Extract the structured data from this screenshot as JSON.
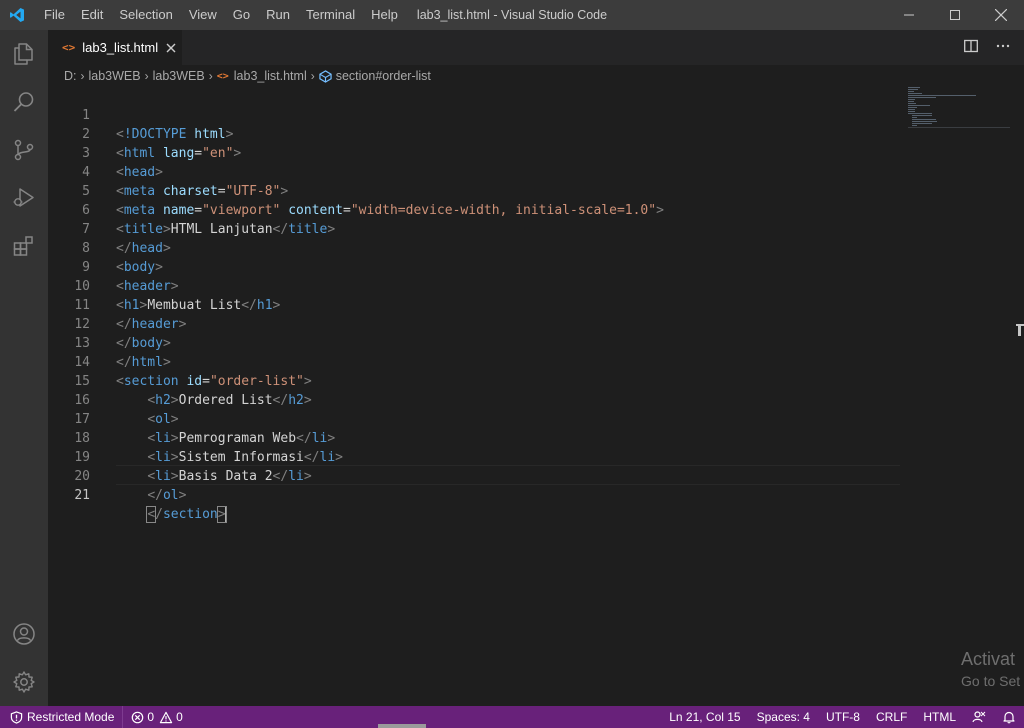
{
  "window": {
    "title": "lab3_list.html - Visual Studio Code",
    "menu": [
      "File",
      "Edit",
      "Selection",
      "View",
      "Go",
      "Run",
      "Terminal",
      "Help"
    ]
  },
  "tab": {
    "label": "lab3_list.html",
    "icon_text": "<>"
  },
  "breadcrumbs": {
    "drive": "D:",
    "folder1": "lab3WEB",
    "folder2": "lab3WEB",
    "file": "lab3_list.html",
    "symbol": "section#order-list"
  },
  "editor": {
    "line_numbers": [
      "1",
      "2",
      "3",
      "4",
      "5",
      "6",
      "7",
      "8",
      "9",
      "10",
      "11",
      "12",
      "13",
      "14",
      "15",
      "16",
      "17",
      "18",
      "19",
      "20",
      "21"
    ],
    "active_line": "21",
    "code": {
      "l1_open": "<",
      "l1_doctype": "!DOCTYPE",
      "l1_html": "html",
      "l1_close": ">",
      "l2_tag": "html",
      "l2_attr": "lang",
      "l2_val": "\"en\"",
      "l3_tag": "head",
      "l4_tag": "meta",
      "l4_attr": "charset",
      "l4_val": "\"UTF-8\"",
      "l5_tag": "meta",
      "l5_attr1": "name",
      "l5_val1": "\"viewport\"",
      "l5_attr2": "content",
      "l5_val2": "\"width=device-width, initial-scale=1.0\"",
      "l6_tag": "title",
      "l6_text": "HTML Lanjutan",
      "l7_tag": "head",
      "l8_tag": "body",
      "l9_tag": "header",
      "l10_tag": "h1",
      "l10_text": "Membuat List",
      "l11_tag": "header",
      "l12_tag": "body",
      "l13_tag": "html",
      "l14_tag": "section",
      "l14_attr": "id",
      "l14_val": "\"order-list\"",
      "l15_tag": "h2",
      "l15_text": "Ordered List",
      "l16_tag": "ol",
      "l17_tag": "li",
      "l17_text": "Pemrograman Web",
      "l18_tag": "li",
      "l18_text": "Sistem Informasi",
      "l19_tag": "li",
      "l19_text": "Basis Data 2",
      "l20_tag": "ol",
      "l21_tag": "section"
    }
  },
  "watermark": {
    "line1": "Activat",
    "line2": "Go to Set"
  },
  "statusbar": {
    "restricted": "Restricted Mode",
    "errors": "0",
    "warnings": "0",
    "position": "Ln 21, Col 15",
    "spaces": "Spaces: 4",
    "encoding": "UTF-8",
    "eol": "CRLF",
    "language": "HTML"
  },
  "colors": {
    "statusbar": "#68217a",
    "tag": "#569cd6",
    "attribute": "#9cdcfe",
    "string": "#ce9178",
    "html_icon": "#e37933"
  }
}
